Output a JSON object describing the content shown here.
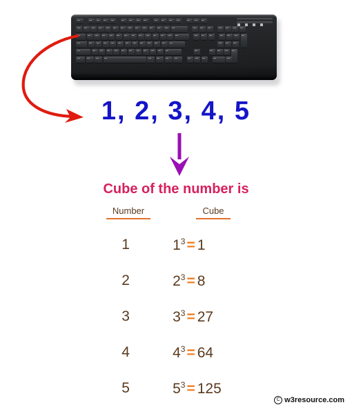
{
  "illustration": {
    "keyboard_alt": "computer-keyboard",
    "input_arrow": "red-curved-arrow",
    "flow_arrow": "purple-down-arrow"
  },
  "input": {
    "sequence_text": "1, 2, 3, 4, 5",
    "numbers": [
      1,
      2,
      3,
      4,
      5
    ],
    "color": "#1414c8"
  },
  "result": {
    "title": "Cube of the number is",
    "title_color": "#d6215e",
    "text_color": "#5a3a1e",
    "accent_color": "#f07d22",
    "columns": [
      "Number",
      "Cube"
    ],
    "rows": [
      {
        "number": "1",
        "base": "1",
        "exponent": "3",
        "equals": "=",
        "value": "1"
      },
      {
        "number": "2",
        "base": "2",
        "exponent": "3",
        "equals": "=",
        "value": "8"
      },
      {
        "number": "3",
        "base": "3",
        "exponent": "3",
        "equals": "=",
        "value": "27"
      },
      {
        "number": "4",
        "base": "4",
        "exponent": "3",
        "equals": "=",
        "value": "64"
      },
      {
        "number": "5",
        "base": "5",
        "exponent": "3",
        "equals": "=",
        "value": "125"
      }
    ]
  },
  "footer": {
    "copyright_symbol": "C",
    "site": "w3resource.com"
  }
}
